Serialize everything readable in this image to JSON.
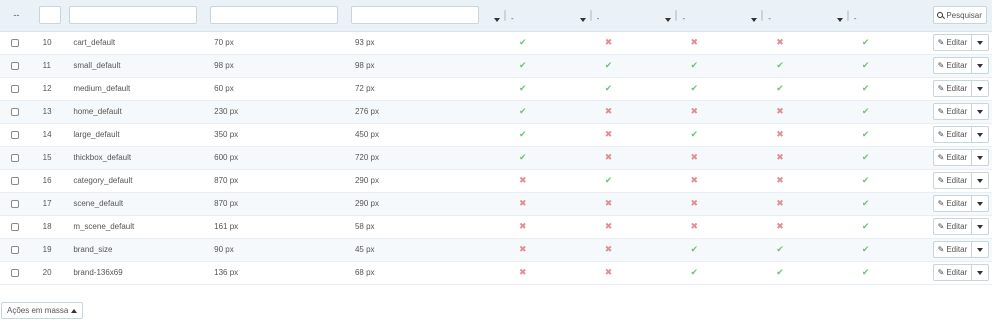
{
  "filters": {
    "dots": "--",
    "select_value": "-",
    "search_label": "Pesquisar"
  },
  "rows": [
    {
      "id": "10",
      "name": "cart_default",
      "width": "70 px",
      "height": "93 px",
      "flags": [
        true,
        false,
        false,
        false,
        true
      ]
    },
    {
      "id": "11",
      "name": "small_default",
      "width": "98 px",
      "height": "98 px",
      "flags": [
        true,
        true,
        true,
        true,
        true
      ]
    },
    {
      "id": "12",
      "name": "medium_default",
      "width": "60 px",
      "height": "72 px",
      "flags": [
        true,
        true,
        true,
        true,
        true
      ]
    },
    {
      "id": "13",
      "name": "home_default",
      "width": "230 px",
      "height": "276 px",
      "flags": [
        true,
        false,
        false,
        false,
        true
      ]
    },
    {
      "id": "14",
      "name": "large_default",
      "width": "350 px",
      "height": "450 px",
      "flags": [
        true,
        false,
        true,
        false,
        true
      ]
    },
    {
      "id": "15",
      "name": "thickbox_default",
      "width": "600 px",
      "height": "720 px",
      "flags": [
        true,
        false,
        false,
        false,
        true
      ]
    },
    {
      "id": "16",
      "name": "category_default",
      "width": "870 px",
      "height": "290 px",
      "flags": [
        false,
        true,
        false,
        false,
        true
      ]
    },
    {
      "id": "17",
      "name": "scene_default",
      "width": "870 px",
      "height": "290 px",
      "flags": [
        false,
        false,
        false,
        false,
        true
      ]
    },
    {
      "id": "18",
      "name": "m_scene_default",
      "width": "161 px",
      "height": "58 px",
      "flags": [
        false,
        false,
        false,
        false,
        true
      ]
    },
    {
      "id": "19",
      "name": "brand_size",
      "width": "90 px",
      "height": "45 px",
      "flags": [
        false,
        false,
        true,
        true,
        true
      ]
    },
    {
      "id": "20",
      "name": "brand-136x69",
      "width": "136 px",
      "height": "68 px",
      "flags": [
        false,
        false,
        true,
        true,
        true
      ]
    }
  ],
  "row_action": {
    "edit_label": "Editar"
  },
  "bulk_actions_label": "Ações em massa",
  "colors": {
    "yes": "#72c279",
    "no": "#e08f95",
    "header_bg": "#eaf2f8"
  },
  "icons": {
    "yes": "check-icon",
    "no": "cross-icon",
    "edit": "pencil-icon",
    "search": "search-icon"
  }
}
